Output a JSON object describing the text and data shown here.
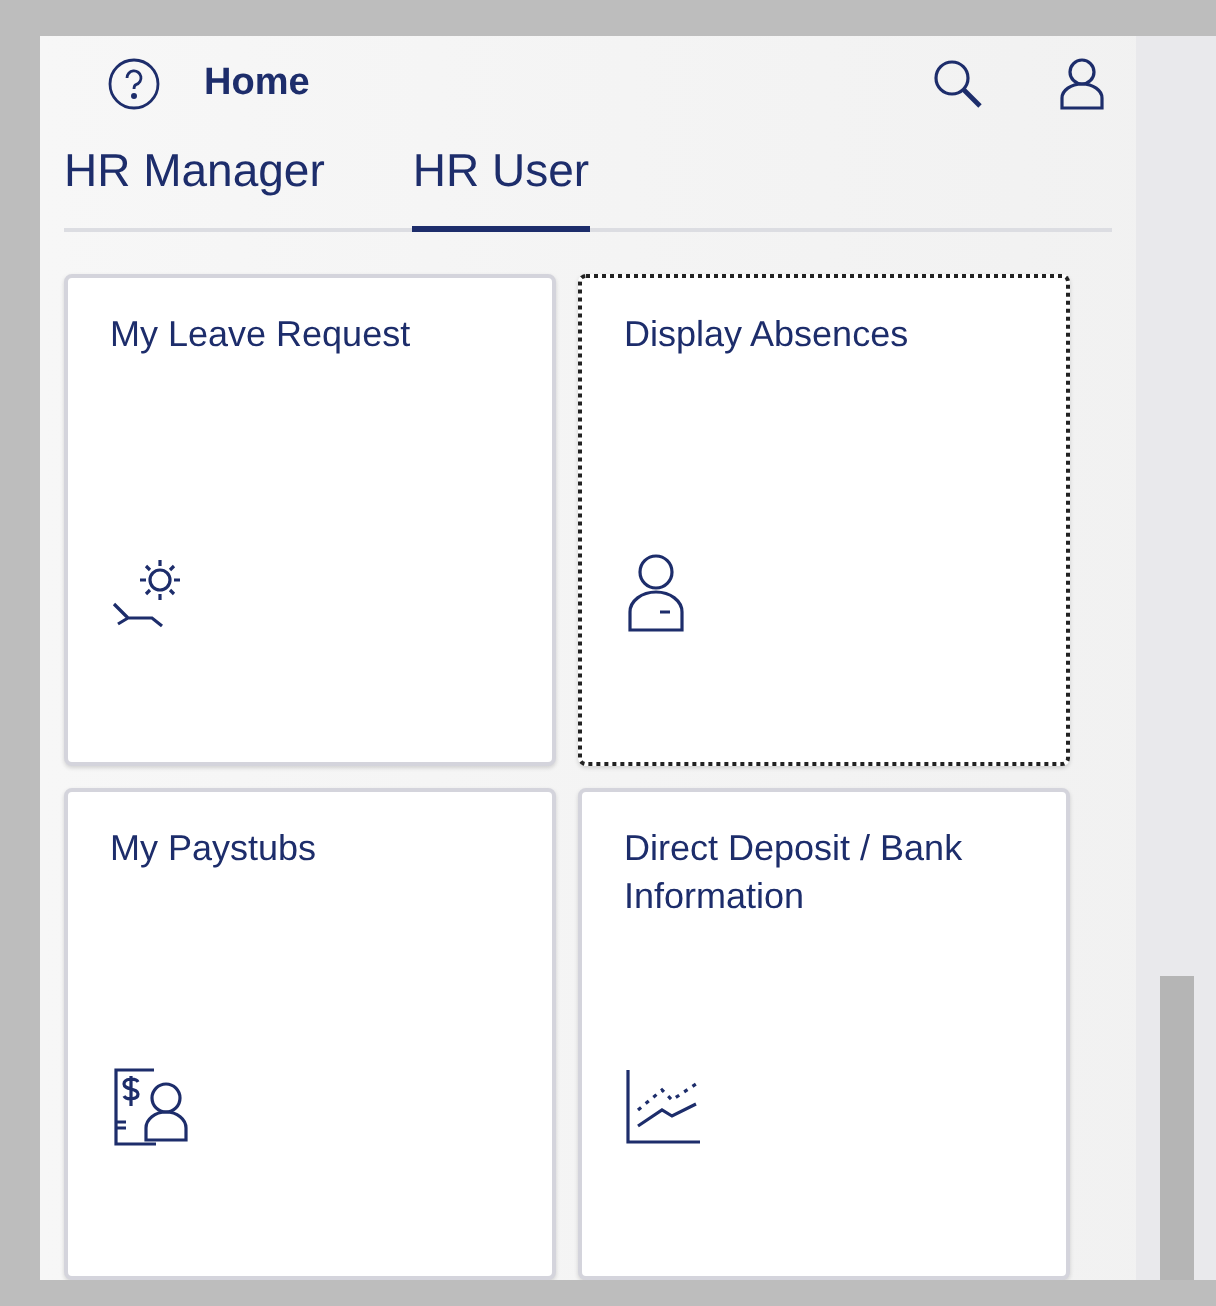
{
  "header": {
    "title": "Home"
  },
  "tabs": [
    {
      "label": "HR Manager",
      "selected": false
    },
    {
      "label": "HR User",
      "selected": true
    }
  ],
  "tiles": [
    {
      "title": "My Leave Request",
      "kind": "leave",
      "focused": false
    },
    {
      "title": "Display Absences",
      "kind": "absence",
      "focused": true
    },
    {
      "title": "My Paystubs",
      "kind": "paystub",
      "focused": false
    },
    {
      "title": "Direct Deposit / Bank Information",
      "kind": "chart",
      "focused": false
    }
  ]
}
